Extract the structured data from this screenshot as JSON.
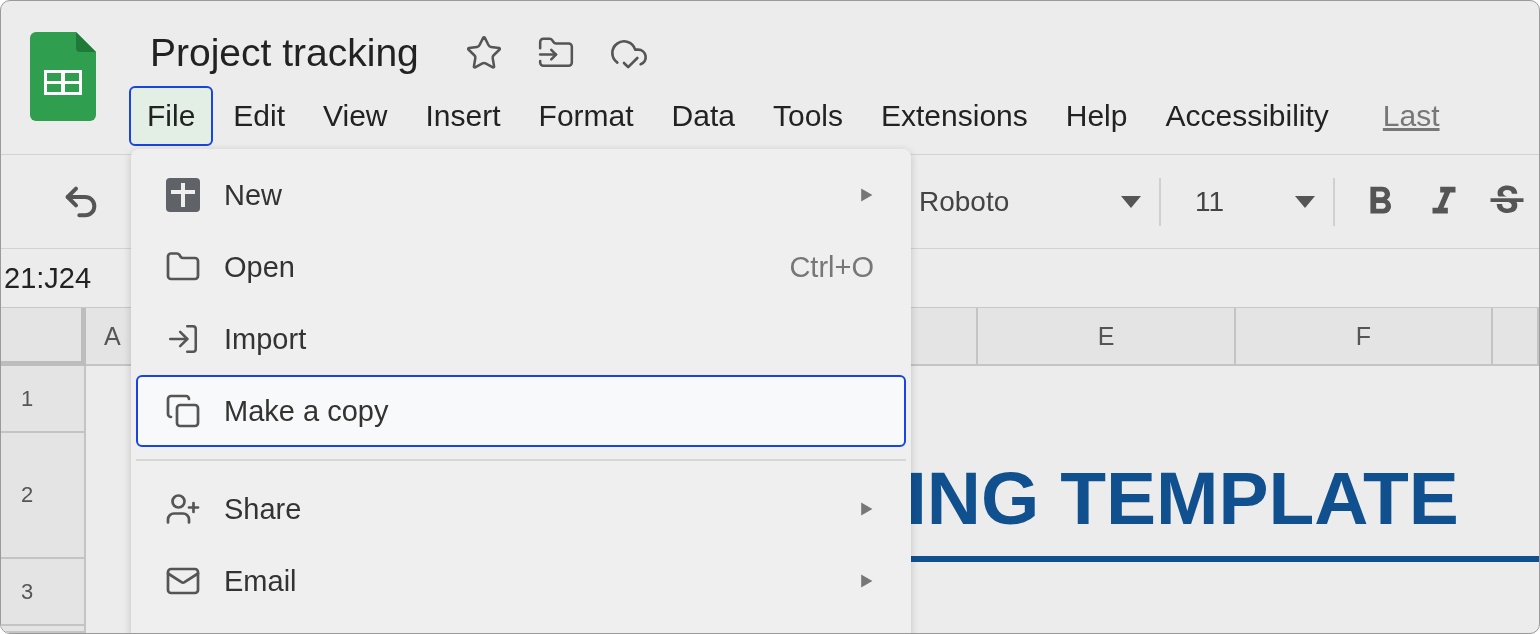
{
  "document": {
    "title": "Project tracking"
  },
  "menubar": [
    {
      "label": "File",
      "selected": true
    },
    {
      "label": "Edit",
      "selected": false
    },
    {
      "label": "View",
      "selected": false
    },
    {
      "label": "Insert",
      "selected": false
    },
    {
      "label": "Format",
      "selected": false
    },
    {
      "label": "Data",
      "selected": false
    },
    {
      "label": "Tools",
      "selected": false
    },
    {
      "label": "Extensions",
      "selected": false
    },
    {
      "label": "Help",
      "selected": false
    },
    {
      "label": "Accessibility",
      "selected": false
    }
  ],
  "last_edit_link": "Last",
  "toolbar": {
    "font": "Roboto",
    "font_size": "11"
  },
  "name_box": "21:J24",
  "columns": [
    "A",
    "E",
    "F"
  ],
  "rows": [
    "1",
    "2",
    "3"
  ],
  "sheet_title": "ING TEMPLATE",
  "file_menu": [
    {
      "kind": "item",
      "label": "New",
      "submenu": true,
      "selected": false
    },
    {
      "kind": "item",
      "label": "Open",
      "shortcut": "Ctrl+O",
      "submenu": false,
      "selected": false
    },
    {
      "kind": "item",
      "label": "Import",
      "submenu": false,
      "selected": false
    },
    {
      "kind": "item",
      "label": "Make a copy",
      "submenu": false,
      "selected": true
    },
    {
      "kind": "divider"
    },
    {
      "kind": "item",
      "label": "Share",
      "submenu": true,
      "selected": false
    },
    {
      "kind": "item",
      "label": "Email",
      "submenu": true,
      "selected": false
    }
  ]
}
